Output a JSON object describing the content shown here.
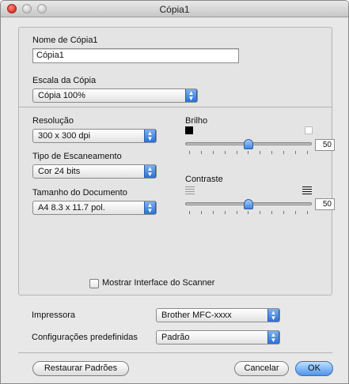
{
  "window": {
    "title": "Cópia1"
  },
  "name_section": {
    "label": "Nome de Cópia1",
    "value": "Cópia1"
  },
  "scale": {
    "label": "Escala da Cópia",
    "selected": "Cópia 100%"
  },
  "resolution": {
    "label": "Resolução",
    "selected": "300 x 300 dpi"
  },
  "scan_type": {
    "label": "Tipo de Escaneamento",
    "selected": "Cor 24 bits"
  },
  "document_size": {
    "label": "Tamanho do Documento",
    "selected": "A4 8.3 x 11.7 pol."
  },
  "brightness": {
    "label": "Brilho",
    "value": "50",
    "level": 0.5,
    "dark_swatch_color": "#000000",
    "light_swatch_color": "#ffffff"
  },
  "contrast": {
    "label": "Contraste",
    "value": "50",
    "level": 0.5
  },
  "show_scanner_interface": {
    "label": "Mostrar Interface do Scanner",
    "checked": false
  },
  "printer": {
    "label": "Impressora",
    "selected": "Brother MFC-xxxx"
  },
  "presets": {
    "label": "Configurações predefinidas",
    "selected": "Padrão"
  },
  "buttons": {
    "restore": "Restaurar Padrões",
    "cancel": "Cancelar",
    "ok": "OK"
  },
  "icons": {
    "close": "close-icon",
    "minimize": "minimize-icon",
    "zoom": "zoom-icon",
    "popup": "popup-arrows-icon",
    "contrast_low": "low-contrast-icon",
    "contrast_high": "high-contrast-icon"
  },
  "colors": {
    "accent": "#3f86e0",
    "close_button": "#d6362a"
  }
}
